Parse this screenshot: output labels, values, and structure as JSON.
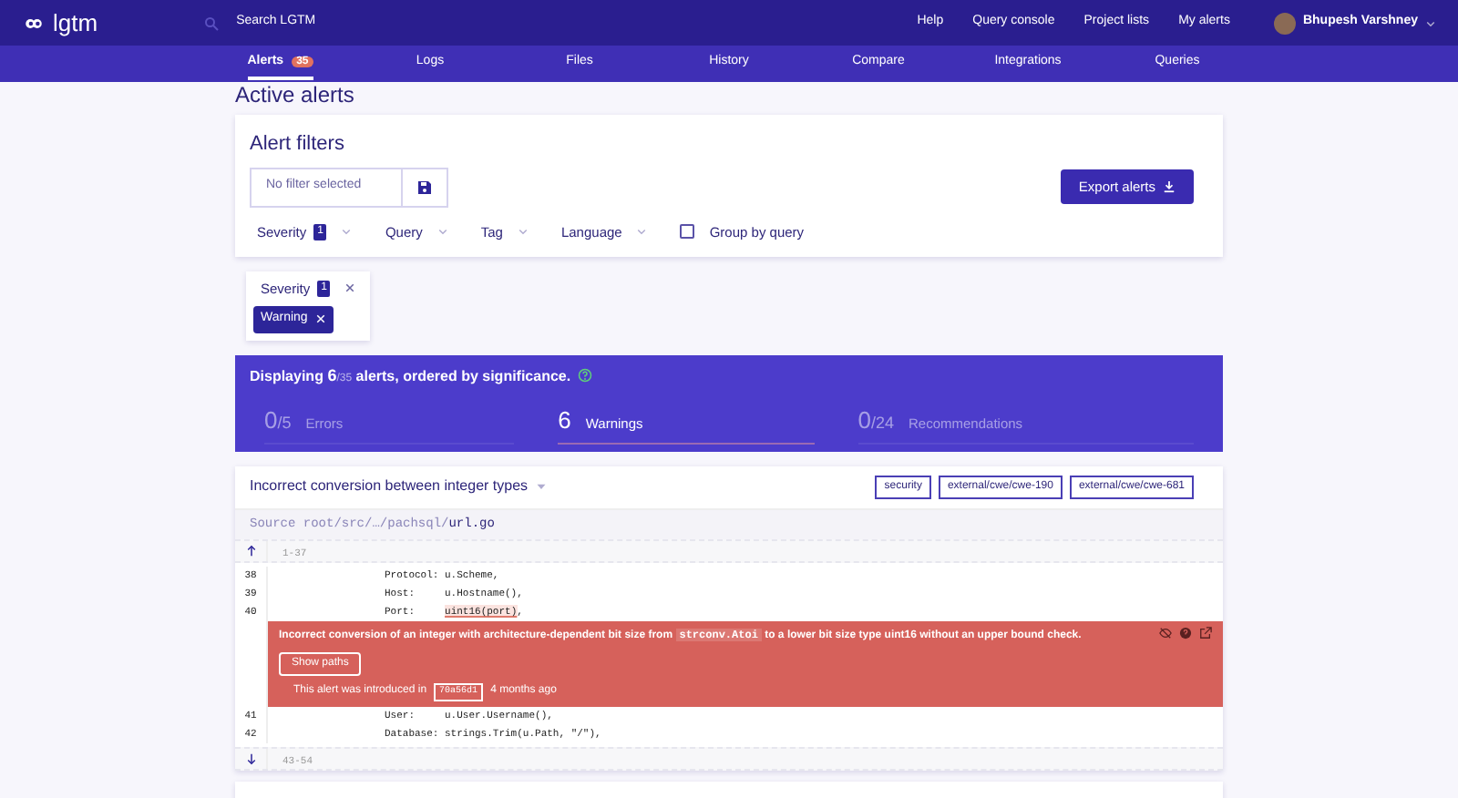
{
  "nav": {
    "brand": "lgtm",
    "search": {
      "placeholder": "Search LGTM"
    },
    "links": [
      "Help",
      "Query console",
      "Project lists",
      "My alerts"
    ],
    "user": "Bhupesh Varshney"
  },
  "tabs": [
    {
      "label": "Alerts",
      "badge": "35",
      "selected": true
    },
    {
      "label": "Logs",
      "selected": false
    },
    {
      "label": "Files",
      "selected": false
    },
    {
      "label": "History",
      "selected": false
    },
    {
      "label": "Compare",
      "selected": false
    },
    {
      "label": "Integrations",
      "selected": false
    },
    {
      "label": "Queries",
      "selected": false
    }
  ],
  "page_title": "Active alerts",
  "filters": {
    "title": "Alert filters",
    "saved_filter": "No filter selected",
    "export": "Export alerts",
    "dropdowns": [
      {
        "label": "Severity",
        "count": "1"
      },
      {
        "label": "Query"
      },
      {
        "label": "Tag"
      },
      {
        "label": "Language"
      }
    ],
    "group_by": {
      "label": "Group by query",
      "checked": false
    }
  },
  "active_filter": {
    "label": "Severity",
    "count": "1",
    "values": [
      "Warning"
    ]
  },
  "summary": {
    "prefix": "Displaying",
    "shown": "6",
    "total": "/35",
    "suffix": "alerts, ordered by significance.",
    "categories": [
      {
        "count": "0",
        "total": "/5",
        "label": "Errors",
        "selected": false
      },
      {
        "count": "6",
        "label": "Warnings",
        "selected": true
      },
      {
        "count": "0",
        "total": "/24",
        "label": "Recommendations",
        "selected": false
      }
    ]
  },
  "alert": {
    "title": "Incorrect conversion between integer types",
    "tags": [
      "security",
      "external/cwe/cwe-190",
      "external/cwe/cwe-681"
    ],
    "source": {
      "path": "Source root/src/…/pachsql/",
      "file": "url.go"
    },
    "range_above": "1-37",
    "lines": [
      {
        "kind": "code",
        "number": "38",
        "text": "Protocol: u.Scheme,"
      },
      {
        "kind": "code",
        "number": "39",
        "text": "Host:     u.Hostname(),"
      },
      {
        "kind": "code",
        "number": "40",
        "text": "Port:     ",
        "highlight": "uint16(port)",
        "after": ","
      },
      {
        "kind": "message",
        "before": "Incorrect conversion of an integer with architecture-dependent bit size from",
        "code": "strconv.Atoi",
        "after": "to a lower bit size type uint16 without an upper bound check.",
        "button": "Show paths",
        "introduced": "This alert was introduced in",
        "commit": "70a56d1",
        "ago": "4 months ago"
      },
      {
        "kind": "code",
        "number": "41",
        "text": "User:     u.User.Username(),"
      },
      {
        "kind": "code",
        "number": "42",
        "text": "Database: strings.Trim(u.Path, \"/\"),"
      }
    ],
    "range_below": "43-54"
  }
}
